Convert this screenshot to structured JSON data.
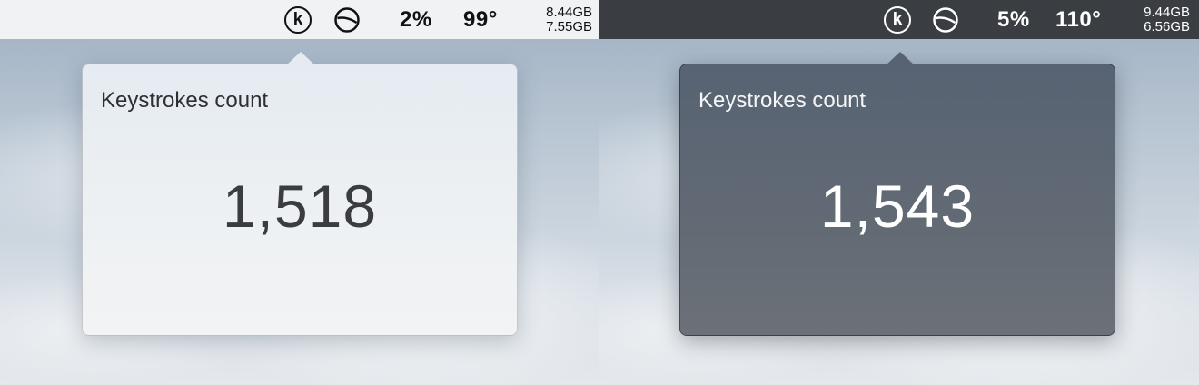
{
  "light": {
    "menubar": {
      "cpu_percent": "2%",
      "temperature": "99°",
      "memory_used": "8.44GB",
      "memory_free": "7.55GB",
      "k_icon_letter": "k"
    },
    "popover": {
      "title": "Keystrokes count",
      "count": "1,518"
    }
  },
  "dark": {
    "menubar": {
      "cpu_percent": "5%",
      "temperature": "110°",
      "memory_used": "9.44GB",
      "memory_free": "6.56GB",
      "k_icon_letter": "k"
    },
    "popover": {
      "title": "Keystrokes count",
      "count": "1,543"
    }
  }
}
